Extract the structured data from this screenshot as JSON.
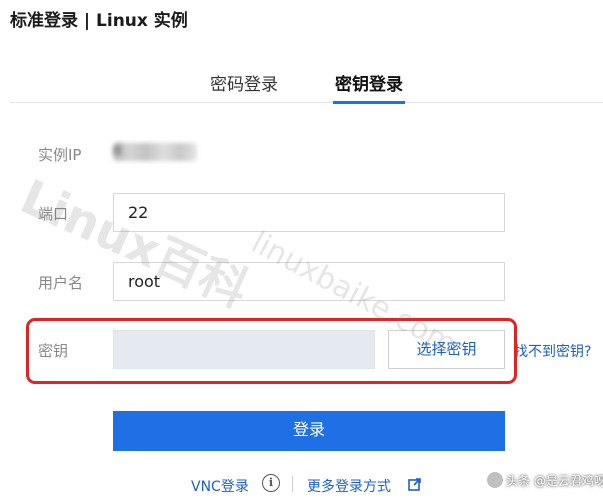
{
  "header": {
    "title": "标准登录 | Linux 实例"
  },
  "tabs": [
    {
      "label": "密码登录",
      "active": false
    },
    {
      "label": "密钥登录",
      "active": true
    }
  ],
  "form": {
    "instance_ip_label": "实例IP",
    "instance_ip_value": "4",
    "port_label": "端口",
    "port_value": "22",
    "username_label": "用户名",
    "username_value": "root",
    "key_label": "密钥",
    "key_value": "",
    "select_key_button": "选择密钥",
    "cant_find_key_link": "找不到密钥?"
  },
  "login_button": "登录",
  "footer": {
    "vnc_login": "VNC登录",
    "more_methods": "更多登录方式"
  },
  "icons": {
    "info": "info-icon",
    "external_link": "external-link-icon"
  },
  "watermark": {
    "main": "Linux百科",
    "url": "linuxbaike.com"
  },
  "credit": "头条 @是云君鸡呀",
  "colors": {
    "accent": "#1f6fe5",
    "link": "#1d5fd0",
    "highlight": "#e02424",
    "disabled_input": "#e5e9f0"
  }
}
